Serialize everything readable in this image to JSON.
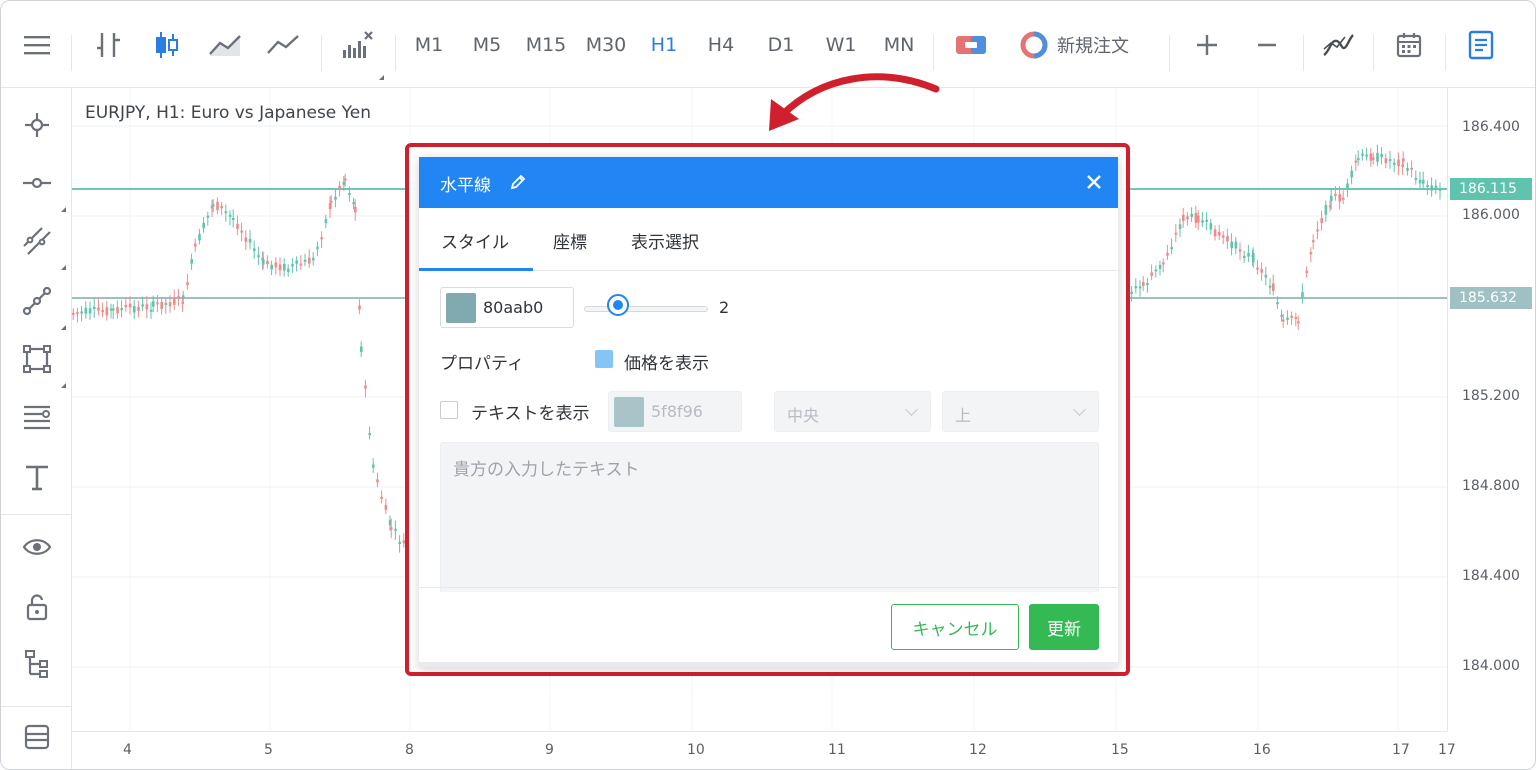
{
  "toolbar": {
    "timeframes": [
      {
        "label": "M1",
        "active": false
      },
      {
        "label": "M5",
        "active": false
      },
      {
        "label": "M15",
        "active": false
      },
      {
        "label": "M30",
        "active": false
      },
      {
        "label": "H1",
        "active": true
      },
      {
        "label": "H4",
        "active": false
      },
      {
        "label": "D1",
        "active": false
      },
      {
        "label": "W1",
        "active": false
      },
      {
        "label": "MN",
        "active": false
      }
    ],
    "new_order_label": "新規注文"
  },
  "chart": {
    "title": "EURJPY, H1: Euro vs Japanese Yen",
    "y_labels": [
      "186.400",
      "186.000",
      "185.200",
      "184.800",
      "184.400",
      "184.000"
    ],
    "x_labels": [
      "4",
      "5",
      "8",
      "9",
      "10",
      "11",
      "12",
      "15",
      "16",
      "17",
      "17"
    ],
    "badges": [
      {
        "value": "186.115",
        "color": "#5fc4ae"
      },
      {
        "value": "185.632",
        "color": "#9fc1c3"
      }
    ],
    "colors": {
      "up": "#5fc4ae",
      "down": "#f08a8a",
      "line1": "#6ec6b5",
      "line2": "#9fbfc2"
    }
  },
  "dialog": {
    "title": "水平線",
    "tabs": [
      "スタイル",
      "座標",
      "表示選択"
    ],
    "line_color": {
      "hex": "80aab0",
      "swatch": "#80aab0"
    },
    "width_value": "2",
    "properties_label": "プロパティ",
    "show_price_label": "価格を表示",
    "show_price_checked": true,
    "show_text_label": "テキストを表示",
    "show_text_checked": false,
    "text_color": {
      "hex": "5f8f96",
      "swatch": "#a9c4c8"
    },
    "align_h": "中央",
    "align_v": "上",
    "text_placeholder": "貴方の入力したテキスト",
    "cancel_label": "キャンセル",
    "update_label": "更新",
    "accent": "#2185f3",
    "update_color": "#35b955"
  }
}
